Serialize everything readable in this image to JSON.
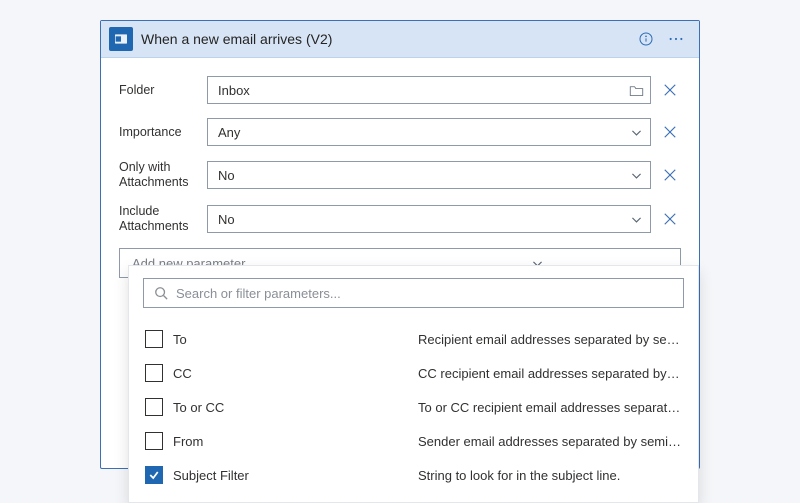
{
  "header": {
    "title": "When a new email arrives (V2)"
  },
  "fields": {
    "folder": {
      "label": "Folder",
      "value": "Inbox"
    },
    "importance": {
      "label": "Importance",
      "value": "Any"
    },
    "onlyAttach": {
      "label": "Only with Attachments",
      "value": "No"
    },
    "includeAttach": {
      "label": "Include Attachments",
      "value": "No"
    }
  },
  "addParam": {
    "placeholder": "Add new parameter"
  },
  "search": {
    "placeholder": "Search or filter parameters..."
  },
  "params": [
    {
      "name": "To",
      "desc": "Recipient email addresses separated by semicolons",
      "checked": false
    },
    {
      "name": "CC",
      "desc": "CC recipient email addresses separated by semicolons",
      "checked": false
    },
    {
      "name": "To or CC",
      "desc": "To or CC recipient email addresses separated by semicolons",
      "checked": false
    },
    {
      "name": "From",
      "desc": "Sender email addresses separated by semicolons",
      "checked": false
    },
    {
      "name": "Subject Filter",
      "desc": "String to look for in the subject line.",
      "checked": true
    }
  ]
}
